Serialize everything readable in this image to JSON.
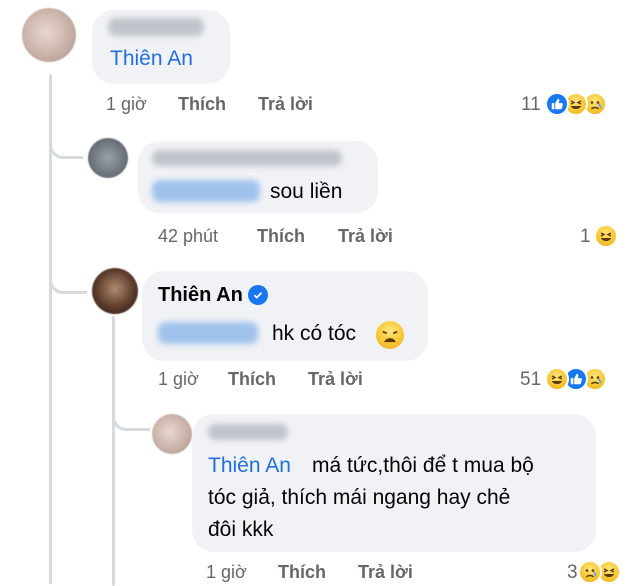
{
  "comments": [
    {
      "id": "c1",
      "author_tag": "Thiên An",
      "time": "1 giờ",
      "like_label": "Thích",
      "reply_label": "Trả lời",
      "reaction_count": "11",
      "reactions": [
        "like-icon",
        "haha-icon",
        "sad-icon"
      ]
    },
    {
      "id": "c2",
      "text": "sou liền",
      "time": "42 phút",
      "like_label": "Thích",
      "reply_label": "Trả lời",
      "reaction_count": "1",
      "reactions": [
        "haha-icon"
      ]
    },
    {
      "id": "c3",
      "author": "Thiên An",
      "verified": true,
      "text": "hk có tóc",
      "emoji": "weary-face-icon",
      "time": "1 giờ",
      "like_label": "Thích",
      "reply_label": "Trả lời",
      "reaction_count": "51",
      "reactions": [
        "haha-icon",
        "like-icon",
        "sad-icon"
      ]
    },
    {
      "id": "c4",
      "mention": "Thiên An",
      "text_line1": "má tức,thôi để t mua bộ",
      "text_line2": "tóc giả, thích mái ngang hay chẻ",
      "text_line3": "đôi kkk",
      "time": "1 giờ",
      "like_label": "Thích",
      "reply_label": "Trả lời",
      "reaction_count": "3",
      "reactions": [
        "sad-icon",
        "haha-icon"
      ]
    }
  ],
  "colors": {
    "accent_blue": "#216fdb",
    "meta_grey": "#65676b",
    "bubble_bg": "#f0f2f5"
  }
}
